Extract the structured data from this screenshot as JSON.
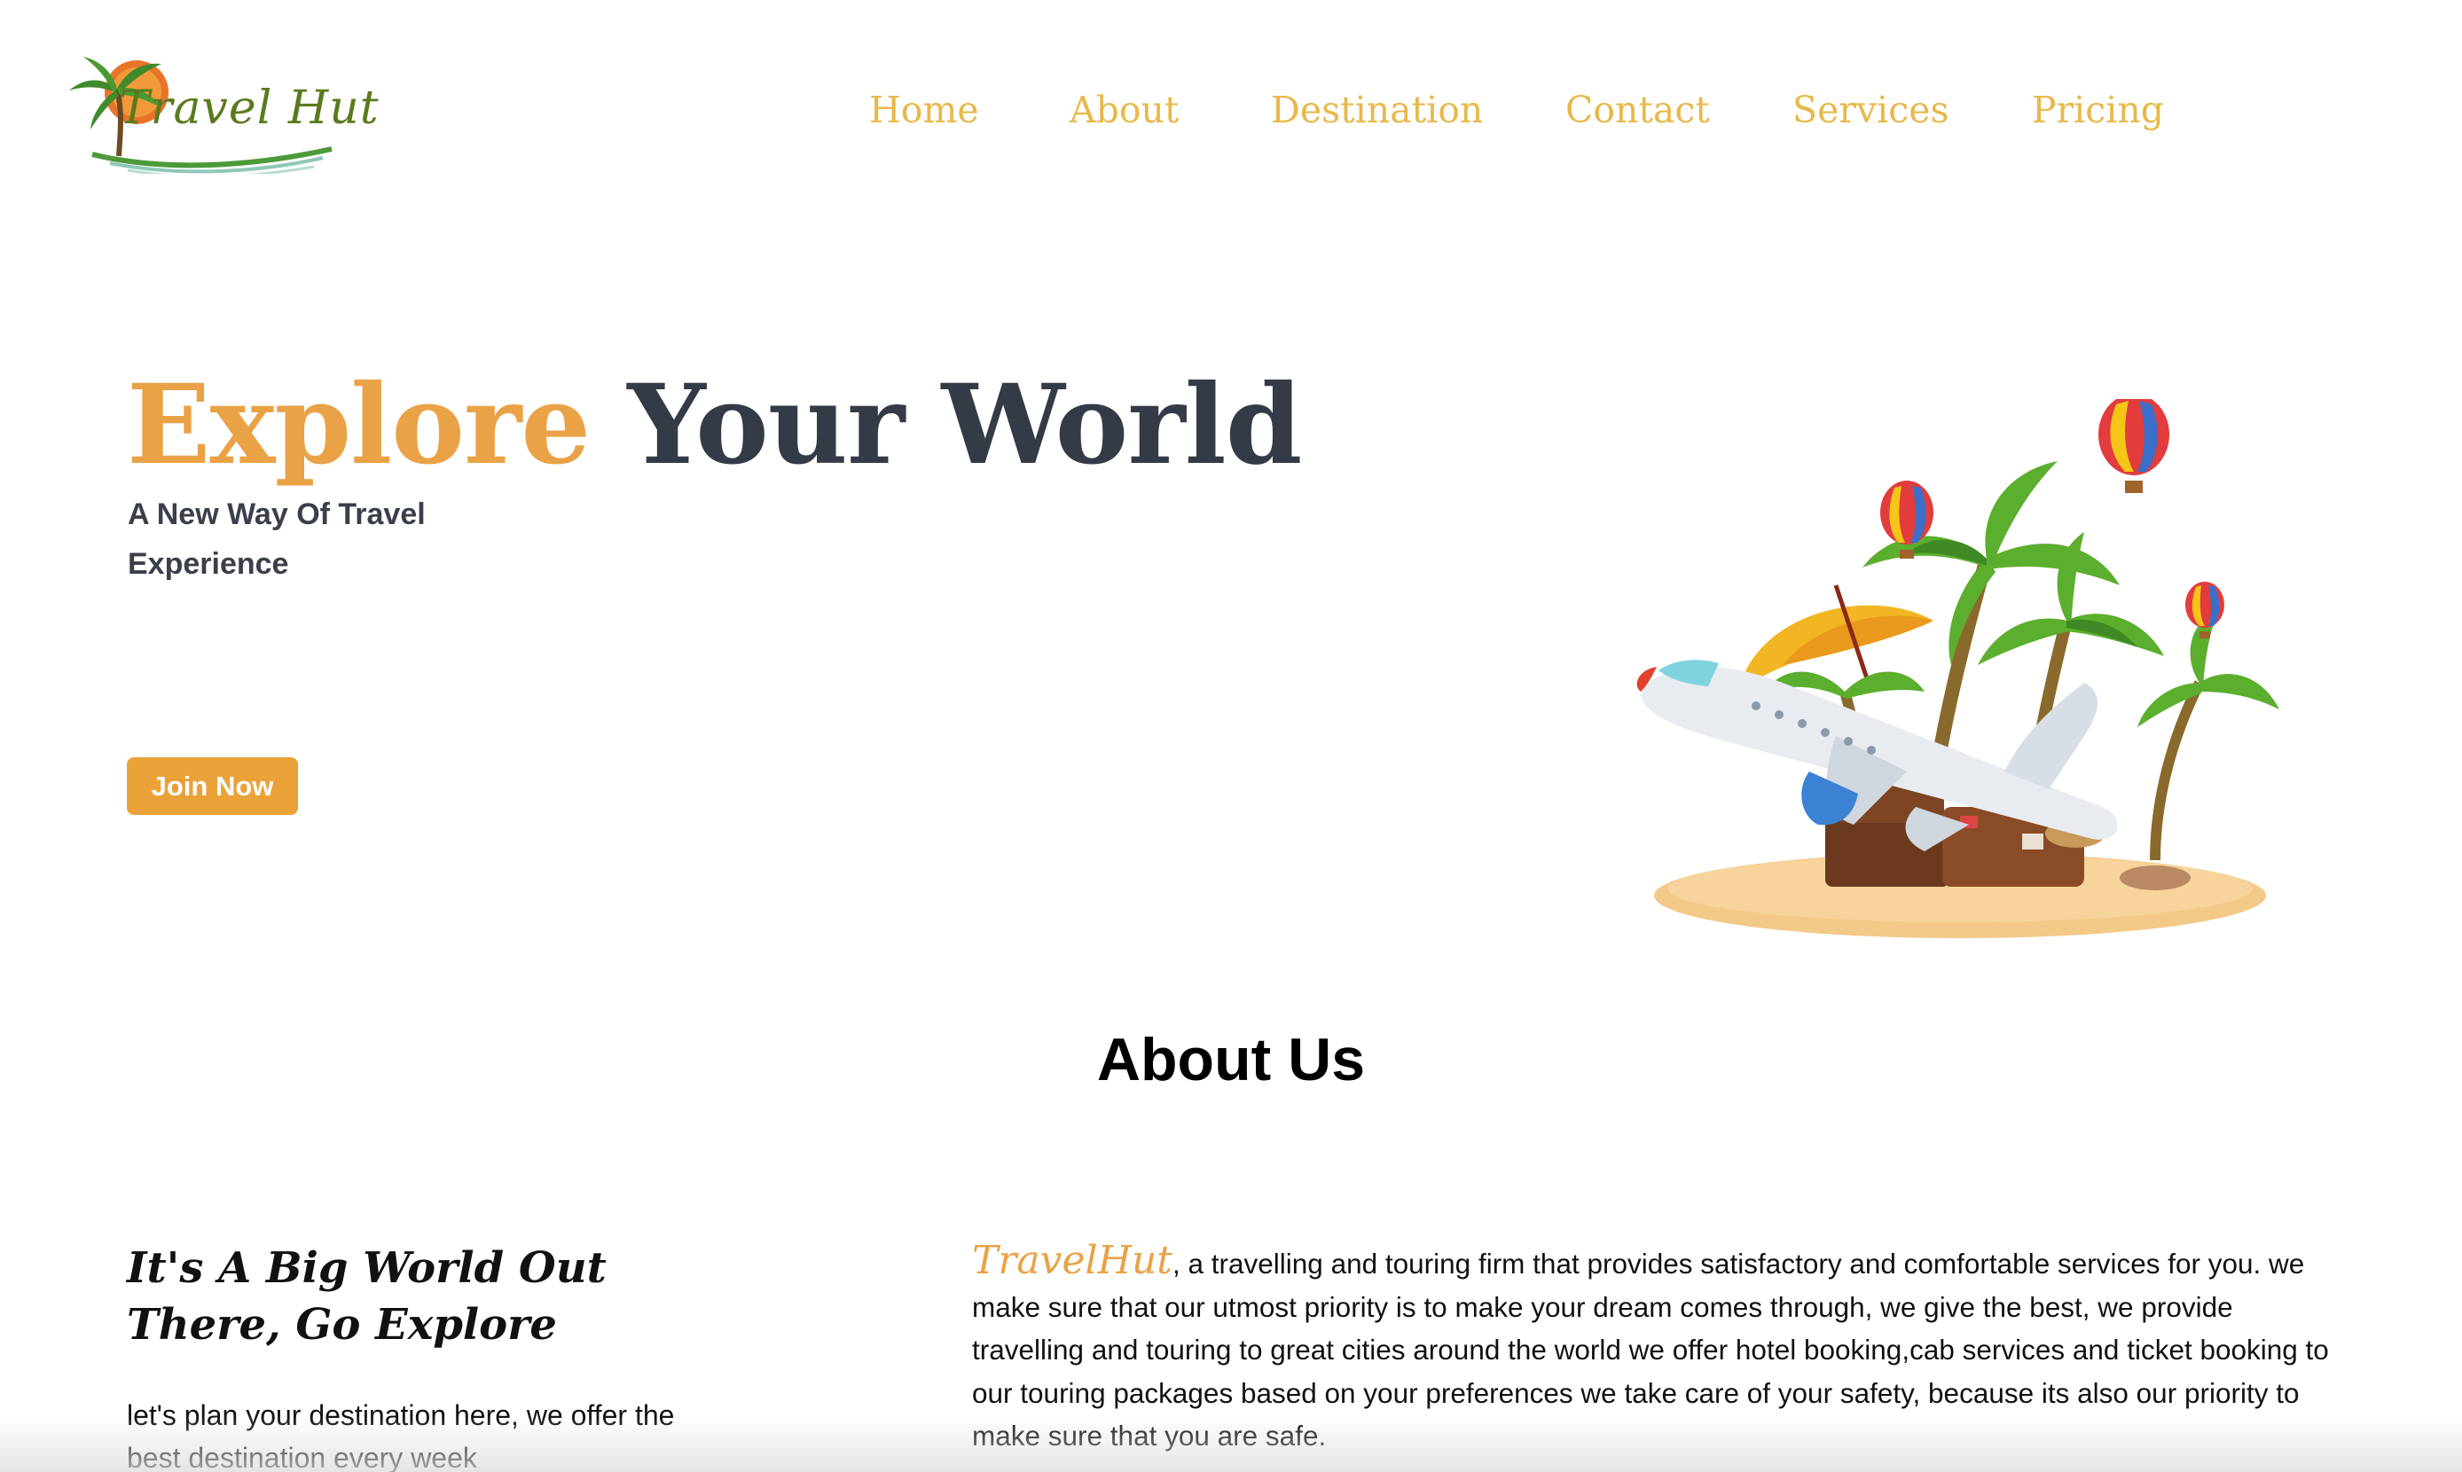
{
  "brand": {
    "logo_text": "Travel Hut"
  },
  "nav": {
    "items": [
      {
        "label": "Home"
      },
      {
        "label": "About"
      },
      {
        "label": "Destination"
      },
      {
        "label": "Contact"
      },
      {
        "label": "Services"
      },
      {
        "label": "Pricing"
      }
    ]
  },
  "hero": {
    "title_accent": "Explore",
    "title_rest": " Your World",
    "subtitle": "A New Way Of Travel Experience",
    "cta_label": "Join Now",
    "illustration_icon": "airplane-island-illustration"
  },
  "about": {
    "title": "About Us",
    "left_heading": "It's A Big World Out There, Go Explore",
    "left_text": "let's plan your destination here, we offer the best destination every week",
    "brand_name": "TravelHut",
    "body": ", a travelling and touring firm that provides satisfactory and comfortable services for you. we make sure that our utmost priority is to make your dream comes through, we give the best, we provide travelling and touring to great cities around the world we offer hotel booking,cab services and ticket booking to our touring packages based on your preferences we take care of your safety, because its also our priority to make sure that you are safe."
  },
  "colors": {
    "accent": "#eaa246",
    "nav": "#e8b84a",
    "dark_text": "#353a47",
    "button": "#eaa238"
  }
}
